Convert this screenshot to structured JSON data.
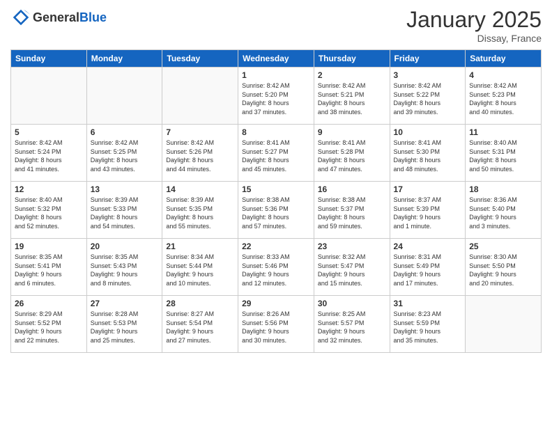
{
  "header": {
    "logo_general": "General",
    "logo_blue": "Blue",
    "month_title": "January 2025",
    "subtitle": "Dissay, France"
  },
  "weekdays": [
    "Sunday",
    "Monday",
    "Tuesday",
    "Wednesday",
    "Thursday",
    "Friday",
    "Saturday"
  ],
  "weeks": [
    [
      {
        "day": "",
        "info": ""
      },
      {
        "day": "",
        "info": ""
      },
      {
        "day": "",
        "info": ""
      },
      {
        "day": "1",
        "info": "Sunrise: 8:42 AM\nSunset: 5:20 PM\nDaylight: 8 hours\nand 37 minutes."
      },
      {
        "day": "2",
        "info": "Sunrise: 8:42 AM\nSunset: 5:21 PM\nDaylight: 8 hours\nand 38 minutes."
      },
      {
        "day": "3",
        "info": "Sunrise: 8:42 AM\nSunset: 5:22 PM\nDaylight: 8 hours\nand 39 minutes."
      },
      {
        "day": "4",
        "info": "Sunrise: 8:42 AM\nSunset: 5:23 PM\nDaylight: 8 hours\nand 40 minutes."
      }
    ],
    [
      {
        "day": "5",
        "info": "Sunrise: 8:42 AM\nSunset: 5:24 PM\nDaylight: 8 hours\nand 41 minutes."
      },
      {
        "day": "6",
        "info": "Sunrise: 8:42 AM\nSunset: 5:25 PM\nDaylight: 8 hours\nand 43 minutes."
      },
      {
        "day": "7",
        "info": "Sunrise: 8:42 AM\nSunset: 5:26 PM\nDaylight: 8 hours\nand 44 minutes."
      },
      {
        "day": "8",
        "info": "Sunrise: 8:41 AM\nSunset: 5:27 PM\nDaylight: 8 hours\nand 45 minutes."
      },
      {
        "day": "9",
        "info": "Sunrise: 8:41 AM\nSunset: 5:28 PM\nDaylight: 8 hours\nand 47 minutes."
      },
      {
        "day": "10",
        "info": "Sunrise: 8:41 AM\nSunset: 5:30 PM\nDaylight: 8 hours\nand 48 minutes."
      },
      {
        "day": "11",
        "info": "Sunrise: 8:40 AM\nSunset: 5:31 PM\nDaylight: 8 hours\nand 50 minutes."
      }
    ],
    [
      {
        "day": "12",
        "info": "Sunrise: 8:40 AM\nSunset: 5:32 PM\nDaylight: 8 hours\nand 52 minutes."
      },
      {
        "day": "13",
        "info": "Sunrise: 8:39 AM\nSunset: 5:33 PM\nDaylight: 8 hours\nand 54 minutes."
      },
      {
        "day": "14",
        "info": "Sunrise: 8:39 AM\nSunset: 5:35 PM\nDaylight: 8 hours\nand 55 minutes."
      },
      {
        "day": "15",
        "info": "Sunrise: 8:38 AM\nSunset: 5:36 PM\nDaylight: 8 hours\nand 57 minutes."
      },
      {
        "day": "16",
        "info": "Sunrise: 8:38 AM\nSunset: 5:37 PM\nDaylight: 8 hours\nand 59 minutes."
      },
      {
        "day": "17",
        "info": "Sunrise: 8:37 AM\nSunset: 5:39 PM\nDaylight: 9 hours\nand 1 minute."
      },
      {
        "day": "18",
        "info": "Sunrise: 8:36 AM\nSunset: 5:40 PM\nDaylight: 9 hours\nand 3 minutes."
      }
    ],
    [
      {
        "day": "19",
        "info": "Sunrise: 8:35 AM\nSunset: 5:41 PM\nDaylight: 9 hours\nand 6 minutes."
      },
      {
        "day": "20",
        "info": "Sunrise: 8:35 AM\nSunset: 5:43 PM\nDaylight: 9 hours\nand 8 minutes."
      },
      {
        "day": "21",
        "info": "Sunrise: 8:34 AM\nSunset: 5:44 PM\nDaylight: 9 hours\nand 10 minutes."
      },
      {
        "day": "22",
        "info": "Sunrise: 8:33 AM\nSunset: 5:46 PM\nDaylight: 9 hours\nand 12 minutes."
      },
      {
        "day": "23",
        "info": "Sunrise: 8:32 AM\nSunset: 5:47 PM\nDaylight: 9 hours\nand 15 minutes."
      },
      {
        "day": "24",
        "info": "Sunrise: 8:31 AM\nSunset: 5:49 PM\nDaylight: 9 hours\nand 17 minutes."
      },
      {
        "day": "25",
        "info": "Sunrise: 8:30 AM\nSunset: 5:50 PM\nDaylight: 9 hours\nand 20 minutes."
      }
    ],
    [
      {
        "day": "26",
        "info": "Sunrise: 8:29 AM\nSunset: 5:52 PM\nDaylight: 9 hours\nand 22 minutes."
      },
      {
        "day": "27",
        "info": "Sunrise: 8:28 AM\nSunset: 5:53 PM\nDaylight: 9 hours\nand 25 minutes."
      },
      {
        "day": "28",
        "info": "Sunrise: 8:27 AM\nSunset: 5:54 PM\nDaylight: 9 hours\nand 27 minutes."
      },
      {
        "day": "29",
        "info": "Sunrise: 8:26 AM\nSunset: 5:56 PM\nDaylight: 9 hours\nand 30 minutes."
      },
      {
        "day": "30",
        "info": "Sunrise: 8:25 AM\nSunset: 5:57 PM\nDaylight: 9 hours\nand 32 minutes."
      },
      {
        "day": "31",
        "info": "Sunrise: 8:23 AM\nSunset: 5:59 PM\nDaylight: 9 hours\nand 35 minutes."
      },
      {
        "day": "",
        "info": ""
      }
    ]
  ]
}
